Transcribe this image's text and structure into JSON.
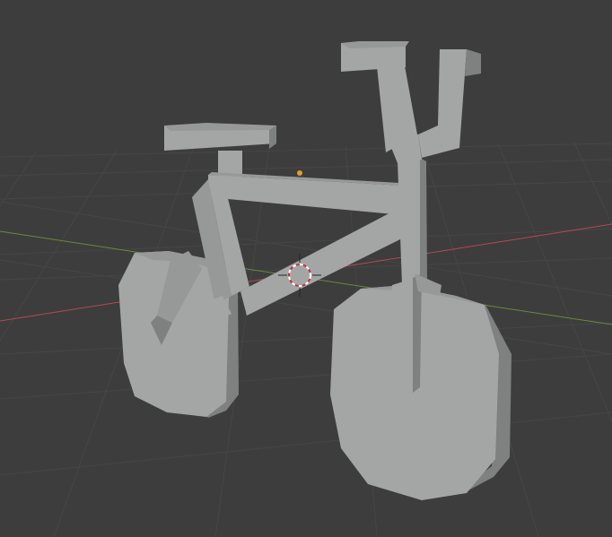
{
  "viewport": {
    "background": "#3d3d3d",
    "grid_color": "#464646",
    "x_axis_color": "#b34a54",
    "y_axis_color": "#6a8a3a",
    "origin_color": "#e89a2c",
    "cursor_colors": [
      "#c8313d",
      "#ffffff"
    ]
  },
  "scene": {
    "object": "bicycle-mesh",
    "shading": "solid",
    "mesh_color": "#a4a6a6"
  }
}
